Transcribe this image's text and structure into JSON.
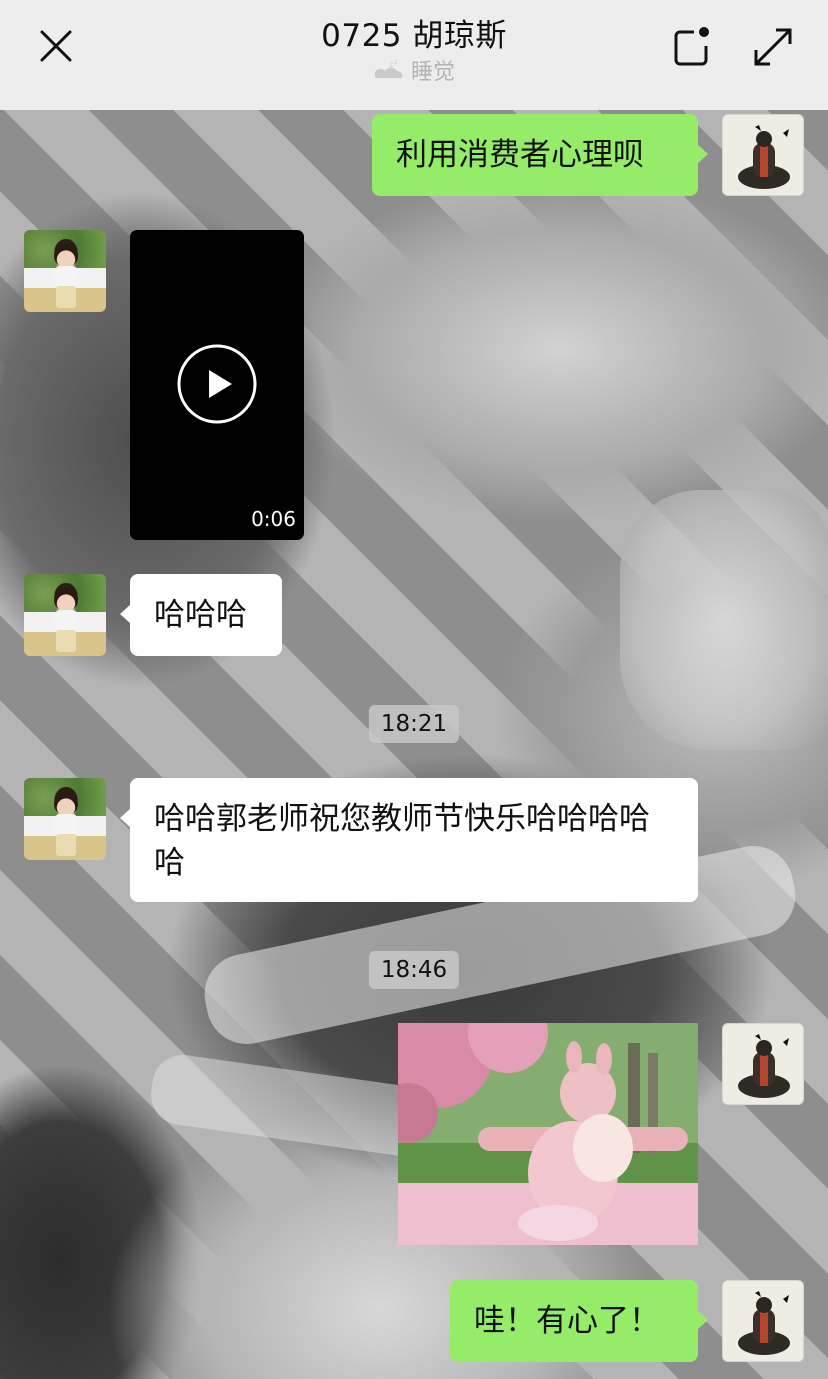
{
  "header": {
    "title": "0725 胡琼斯",
    "status_text": "睡觉"
  },
  "messages": [
    {
      "side": "right",
      "type": "text",
      "text": "利用消费者心理呗"
    },
    {
      "side": "left",
      "type": "video",
      "duration": "0:06"
    },
    {
      "side": "left",
      "type": "text",
      "text": "哈哈哈"
    },
    {
      "type": "timestamp",
      "text": "18:21"
    },
    {
      "side": "left",
      "type": "text",
      "text": "哈哈郭老师祝您教师节快乐哈哈哈哈哈"
    },
    {
      "type": "timestamp",
      "text": "18:46"
    },
    {
      "side": "right",
      "type": "sticker"
    },
    {
      "side": "right",
      "type": "text",
      "text": "哇！有心了！"
    }
  ],
  "colors": {
    "outgoing_bubble": "#95ec69",
    "incoming_bubble": "#ffffff",
    "header_bg": "#ededed"
  }
}
